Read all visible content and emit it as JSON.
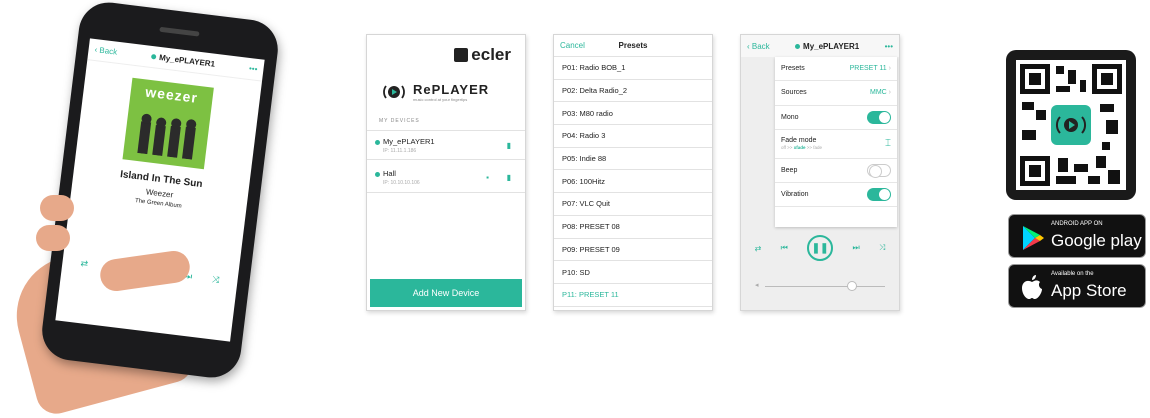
{
  "phone": {
    "back_label": "Back",
    "title": "My_ePLAYER1",
    "menu": "•••",
    "album_brand": "weezer",
    "song": "Island In The Sun",
    "artist": "Weezer",
    "album": "The Green Album"
  },
  "devices_screen": {
    "brand": "ecler",
    "app_name": "RePLAYER",
    "app_tagline": "music control at your fingertips",
    "section_label": "MY DEVICES",
    "devices": [
      {
        "name": "My_ePLAYER1",
        "ip": "IP: 11.11.1.186"
      },
      {
        "name": "Hall",
        "ip": "IP: 10.10.10.106"
      }
    ],
    "add_button": "Add New Device"
  },
  "presets_screen": {
    "cancel": "Cancel",
    "title": "Presets",
    "items": [
      "P01: Radio BOB_1",
      "P02: Delta Radio_2",
      "P03: M80 radio",
      "P04: Radio 3",
      "P05: Indie 88",
      "P06: 100Hitz",
      "P07: VLC Quit",
      "P08: PRESET 08",
      "P09: PRESET 09",
      "P10: SD",
      "P11: PRESET 11"
    ],
    "selected_index": 10
  },
  "settings_screen": {
    "back_label": "Back",
    "title": "My_ePLAYER1",
    "menu": "•••",
    "presets_label": "Presets",
    "presets_value": "PRESET 11",
    "sources_label": "Sources",
    "sources_value": "MMC",
    "mono_label": "Mono",
    "mono_on": true,
    "fade_label": "Fade mode",
    "fade_sub_prefix": "off >> ",
    "fade_sub_active": "xfade",
    "fade_sub_suffix": " >> fade",
    "beep_label": "Beep",
    "beep_on": false,
    "vibration_label": "Vibration",
    "vibration_on": true
  },
  "stores": {
    "google_small": "ANDROID APP ON",
    "google_big": "Google play",
    "apple_small": "Available on the",
    "apple_big": "App Store"
  },
  "colors": {
    "accent": "#2bb79b"
  }
}
